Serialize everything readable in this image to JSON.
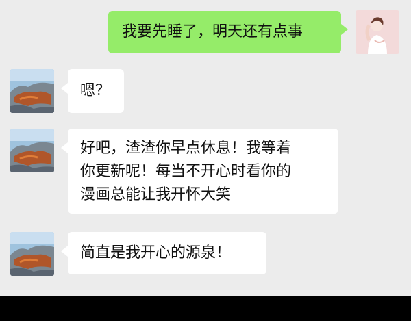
{
  "colors": {
    "chat_background": "#ececec",
    "outgoing_bubble": "#95ec69",
    "incoming_bubble": "#ffffff",
    "bottom_bar": "#000000"
  },
  "messages": [
    {
      "direction": "out",
      "text": "我要先睡了，明天还有点事",
      "avatar": "self-avatar"
    },
    {
      "direction": "in",
      "text": "嗯？",
      "avatar": "contact-avatar"
    },
    {
      "direction": "in",
      "lines": [
        "好吧，渣渣你早点休息！我等着",
        "你更新呢！每当不开心时看你的",
        "漫画总能让我开怀大笑"
      ],
      "avatar": "contact-avatar"
    },
    {
      "direction": "in",
      "text": "简直是我开心的源泉！",
      "avatar": "contact-avatar"
    }
  ]
}
